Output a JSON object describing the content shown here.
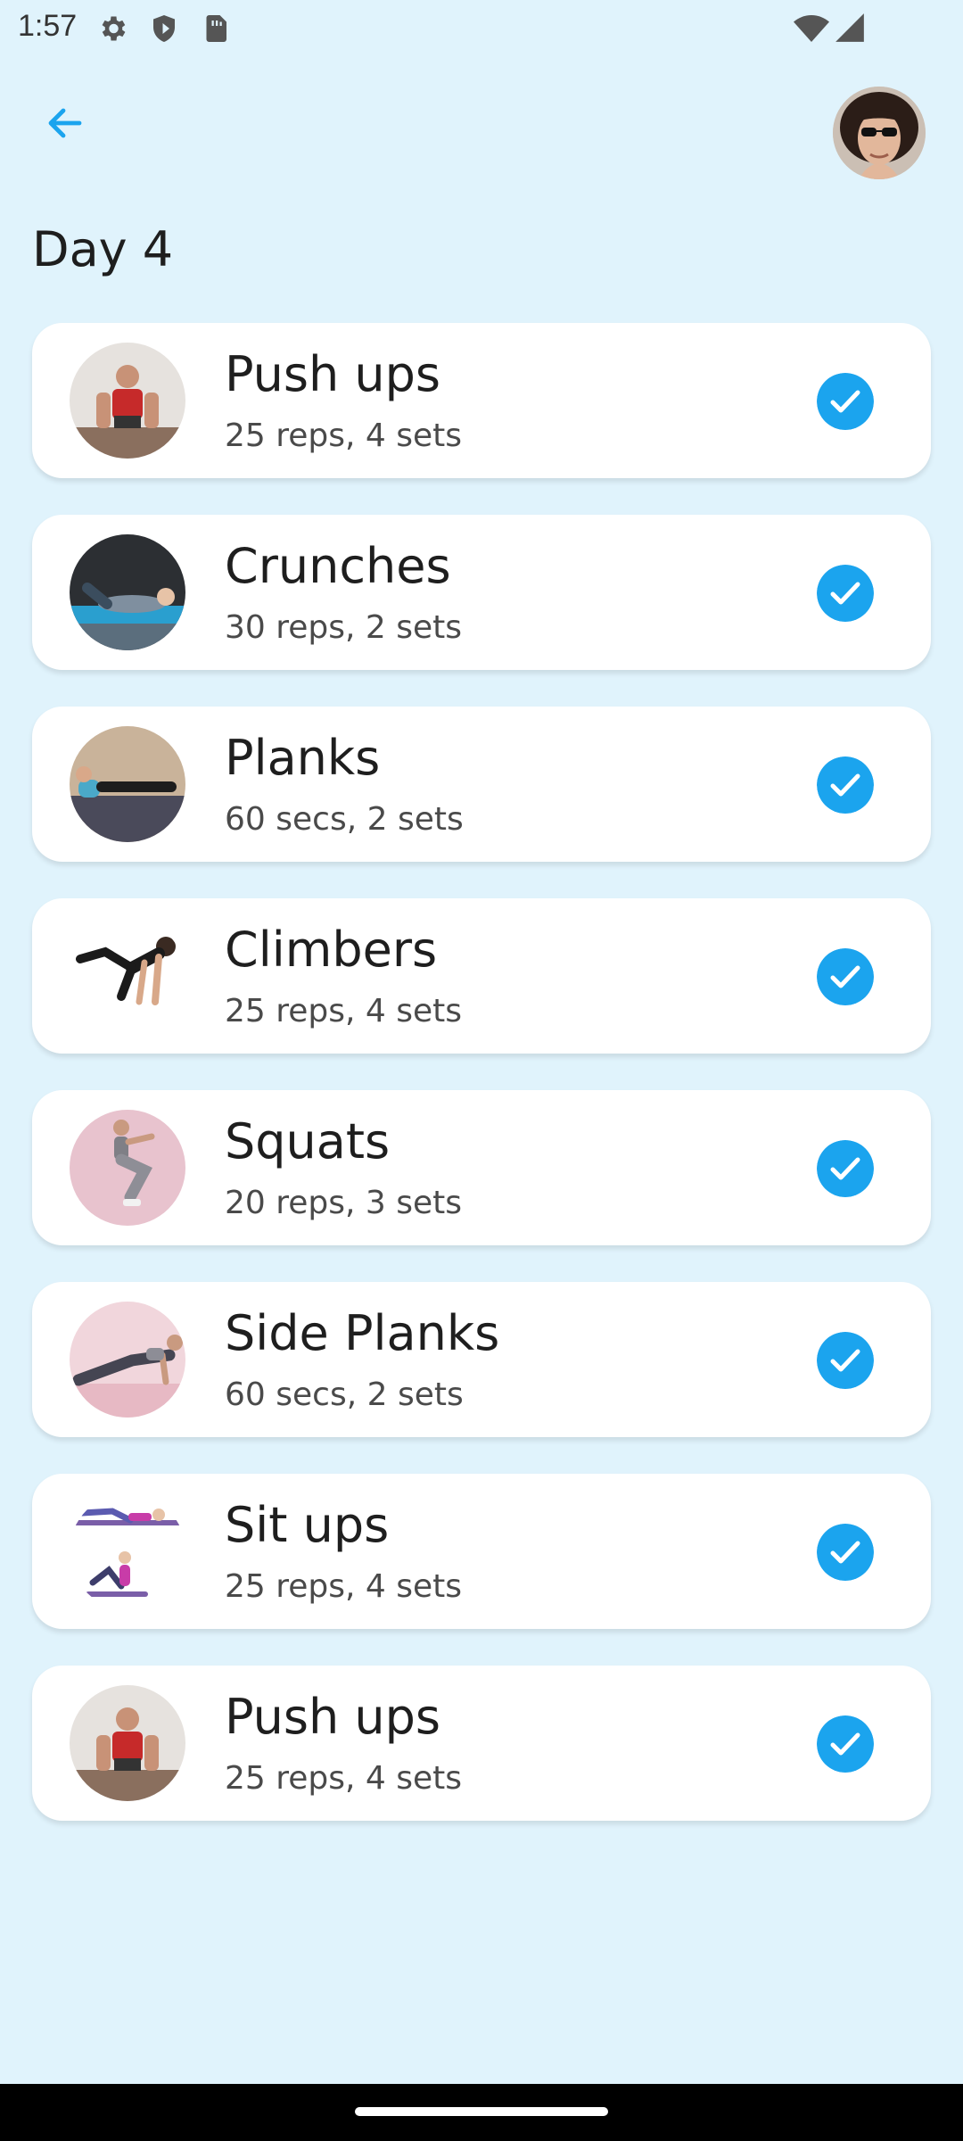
{
  "status_bar": {
    "time": "1:57",
    "icons": [
      "gear-icon",
      "shield-icon",
      "sim-card-icon",
      "wifi-icon",
      "signal-icon"
    ]
  },
  "header": {
    "back_icon": "arrow-left-icon",
    "avatar": "user-avatar"
  },
  "page": {
    "title": "Day 4"
  },
  "colors": {
    "background": "#e0f3fc",
    "accent": "#1ba4ee",
    "card": "#ffffff",
    "check": "#1ba4ee"
  },
  "exercises": [
    {
      "name": "Push ups",
      "detail": "25 reps, 4 sets",
      "completed": true
    },
    {
      "name": "Crunches",
      "detail": "30 reps, 2 sets",
      "completed": true
    },
    {
      "name": "Planks",
      "detail": "60 secs, 2 sets",
      "completed": true
    },
    {
      "name": "Climbers",
      "detail": "25 reps, 4 sets",
      "completed": true
    },
    {
      "name": "Squats",
      "detail": "20 reps, 3 sets",
      "completed": true
    },
    {
      "name": "Side Planks",
      "detail": "60 secs, 2 sets",
      "completed": true
    },
    {
      "name": "Sit ups",
      "detail": "25 reps, 4 sets",
      "completed": true
    },
    {
      "name": "Push ups",
      "detail": "25 reps, 4 sets",
      "completed": true
    }
  ]
}
